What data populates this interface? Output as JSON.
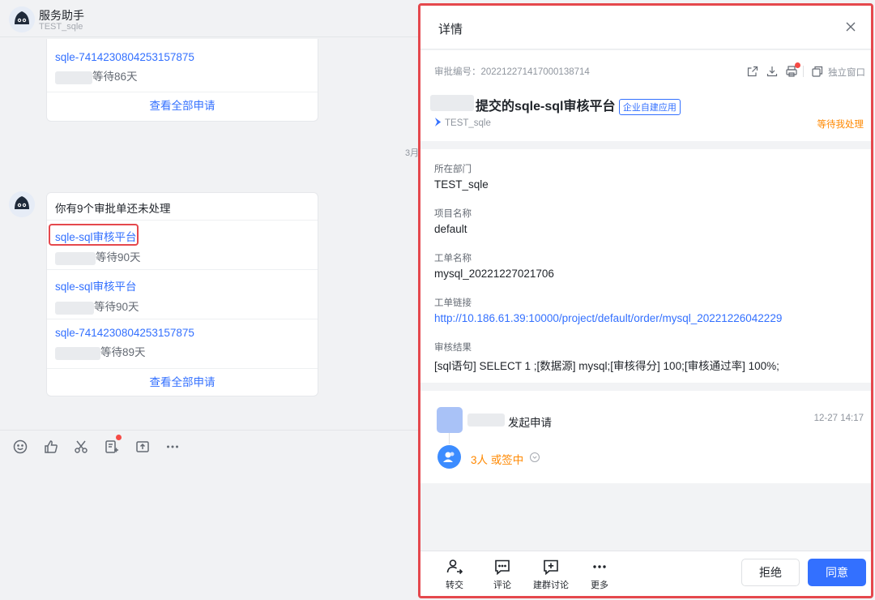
{
  "chat": {
    "bot_name": "服务助手",
    "bot_subtitle": "TEST_sqle",
    "card1": {
      "item_link": "sqle-7414230804253157875",
      "item_wait": "等待86天",
      "view_all": "查看全部申请"
    },
    "date_separator": "3月",
    "card2": {
      "header": "你有9个审批单还未处理",
      "items": [
        {
          "link": "sqle-sql审核平台",
          "wait": "等待90天"
        },
        {
          "link": "sqle-sql审核平台",
          "wait": "等待90天"
        },
        {
          "link": "sqle-7414230804253157875",
          "wait": "等待89天"
        }
      ],
      "view_all": "查看全部申请"
    },
    "toolbar_icons": [
      "emoji-icon",
      "thumbs-up-icon",
      "scissors-icon",
      "task-icon",
      "forward-icon",
      "more-icon"
    ]
  },
  "detail": {
    "title": "详情",
    "approval_no_label": "审批编号：",
    "approval_no": "202212271417000138714",
    "standalone_window": "独立窗口",
    "heading": "提交的sqle-sql审核平台",
    "tag": "企业自建应用",
    "org": "TEST_sqle",
    "status": "等待我处理",
    "fields": [
      {
        "label": "所在部门",
        "value": "TEST_sqle",
        "is_link": false
      },
      {
        "label": "项目名称",
        "value": "default",
        "is_link": false
      },
      {
        "label": "工单名称",
        "value": "mysql_20221227021706",
        "is_link": false
      },
      {
        "label": "工单链接",
        "value": "http://10.186.61.39:10000/project/default/order/mysql_20221226042229",
        "is_link": true
      },
      {
        "label": "审核结果",
        "value": "[sql语句] SELECT 1 ;[数据源] mysql;[审核得分] 100;[审核通过率] 100%;",
        "is_link": false
      }
    ],
    "timeline": {
      "start_text": "发起申请",
      "start_time": "12-27 14:17",
      "pending_text": "3人 或签中"
    },
    "actions": {
      "transfer": "转交",
      "comment": "评论",
      "group": "建群讨论",
      "more": "更多",
      "reject": "拒绝",
      "agree": "同意"
    }
  },
  "colors": {
    "accent": "#3370ff",
    "status_orange": "#ff8800",
    "highlight_red": "#e5484d"
  }
}
